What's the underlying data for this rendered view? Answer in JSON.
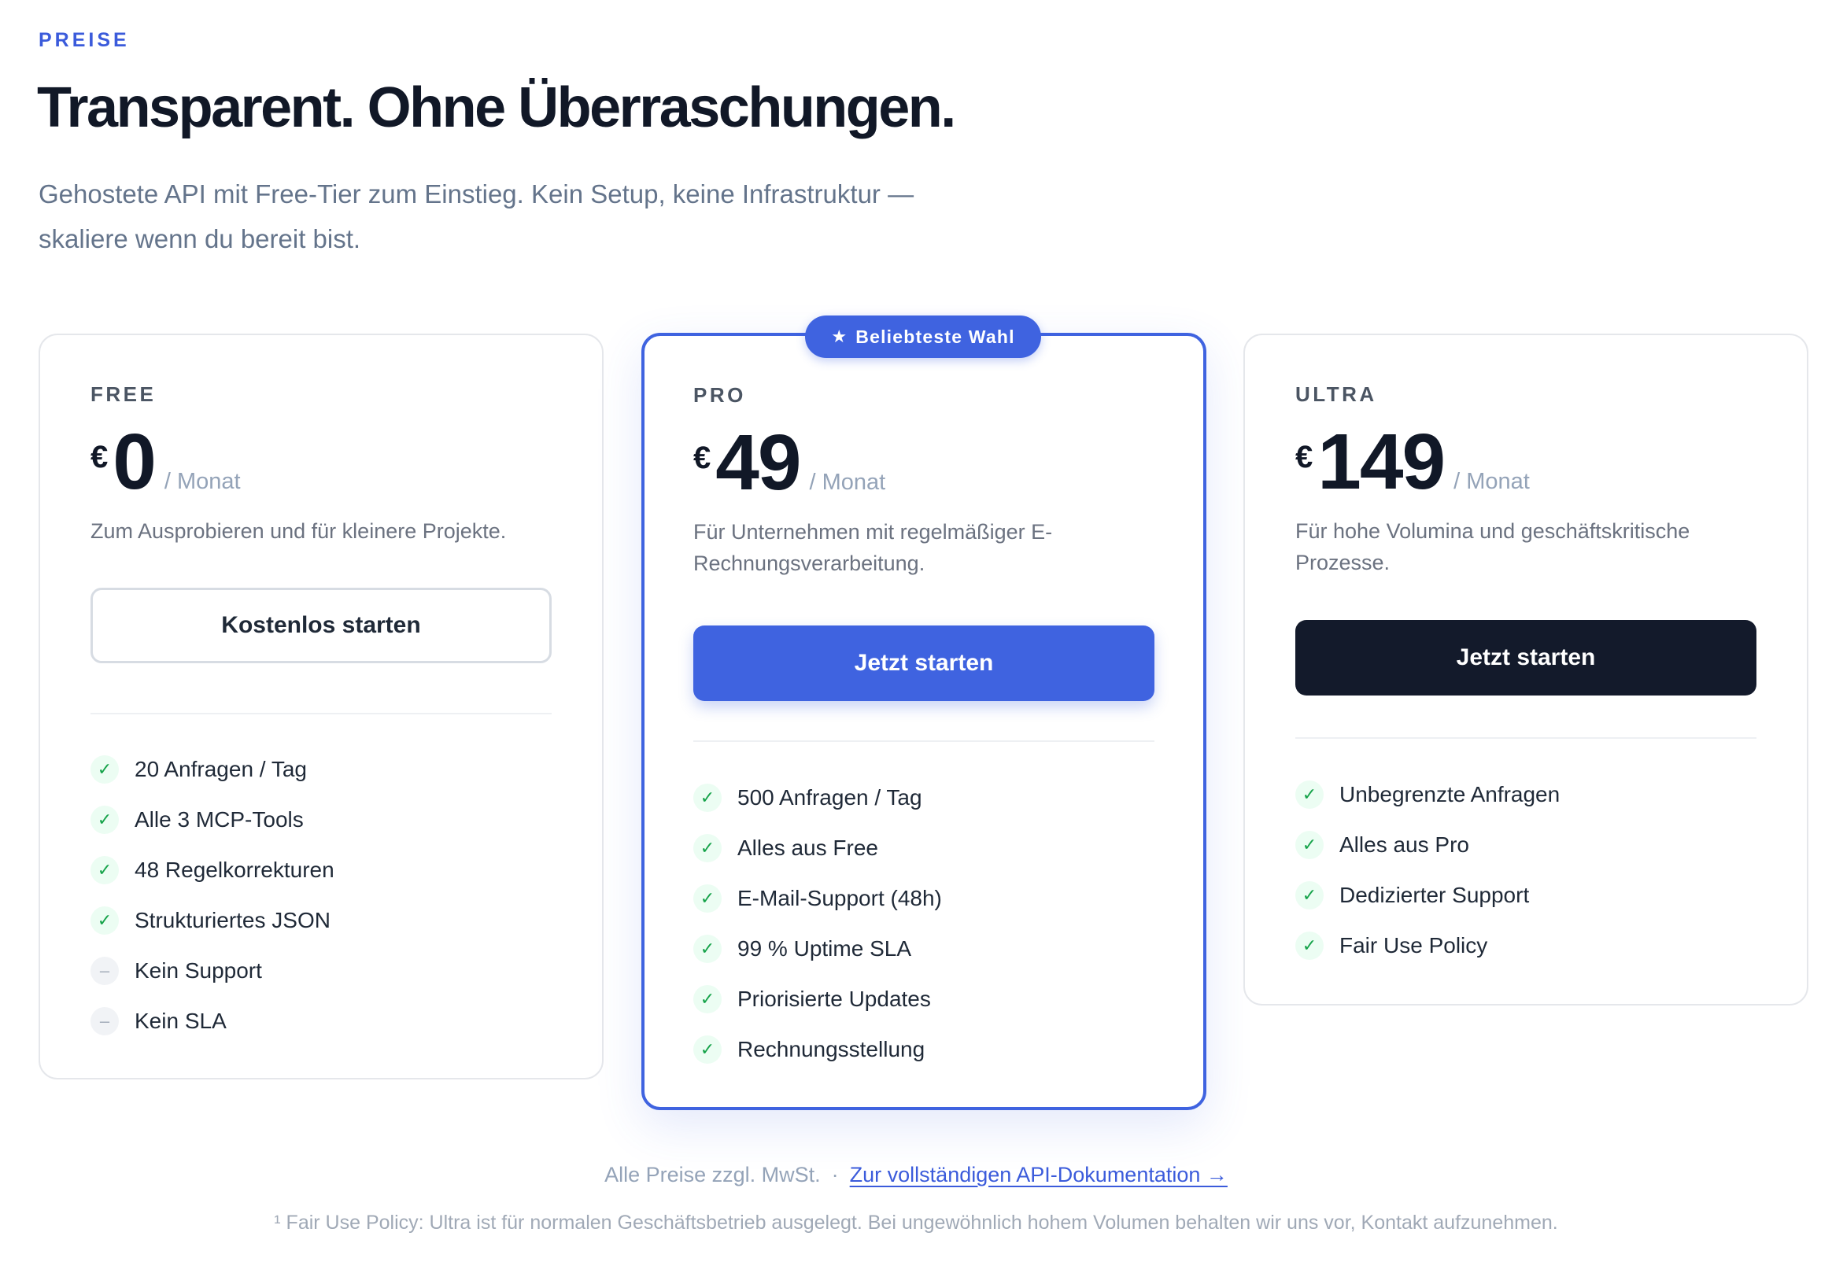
{
  "header": {
    "eyebrow": "PREISE",
    "title": "Transparent. Ohne Überraschungen.",
    "lead": "Gehostete API mit Free-Tier zum Einstieg. Kein Setup, keine Infrastruktur — skaliere wenn du bereit bist."
  },
  "badge": {
    "icon": "star-icon",
    "label": "Beliebteste Wahl"
  },
  "colors": {
    "accent": "#3f63e0",
    "dark_button": "#131a2b",
    "check": "#16a34a"
  },
  "plans": {
    "free": {
      "name": "FREE",
      "currency": "€",
      "price": "0",
      "period": "/ Monat",
      "description": "Zum Ausprobieren und für kleinere Projekte.",
      "cta": "Kostenlos starten",
      "features": [
        {
          "label": "20 Anfragen / Tag",
          "mark": "✓"
        },
        {
          "label": "Alle 3 MCP-Tools",
          "mark": "✓"
        },
        {
          "label": "48 Regelkorrekturen",
          "mark": "✓"
        },
        {
          "label": "Strukturiertes JSON",
          "mark": "✓"
        },
        {
          "label": "Kein Support",
          "mark": "–"
        },
        {
          "label": "Kein SLA",
          "mark": "–"
        }
      ]
    },
    "pro": {
      "name": "PRO",
      "currency": "€",
      "price": "49",
      "period": "/ Monat",
      "description": "Für Unternehmen mit regelmäßiger E-Rechnungsverarbeitung.",
      "cta": "Jetzt starten",
      "features": [
        {
          "label": "500 Anfragen / Tag",
          "mark": "✓"
        },
        {
          "label": "Alles aus Free",
          "mark": "✓"
        },
        {
          "label": "E-Mail-Support (48h)",
          "mark": "✓"
        },
        {
          "label": "99 % Uptime SLA",
          "mark": "✓"
        },
        {
          "label": "Priorisierte Updates",
          "mark": "✓"
        },
        {
          "label": "Rechnungsstellung",
          "mark": "✓"
        }
      ]
    },
    "ultra": {
      "name": "ULTRA",
      "currency": "€",
      "price": "149",
      "period": "/ Monat",
      "description": "Für hohe Volumina und geschäftskritische Prozesse.",
      "cta": "Jetzt starten",
      "features": [
        {
          "label": "Unbegrenzte Anfragen",
          "mark": "✓"
        },
        {
          "label": "Alles aus Pro",
          "mark": "✓"
        },
        {
          "label": "Dedizierter Support",
          "mark": "✓"
        },
        {
          "label": "Fair Use Policy",
          "mark": "✓"
        }
      ]
    }
  },
  "footer": {
    "vat_note": "Alle Preise zzgl. MwSt.",
    "separator": "·",
    "docs_link": "Zur vollständigen API-Dokumentation →",
    "legal": "¹ Fair Use Policy: Ultra ist für normalen Geschäftsbetrieb ausgelegt. Bei ungewöhnlich hohem Volumen behalten wir uns vor, Kontakt aufzunehmen."
  }
}
